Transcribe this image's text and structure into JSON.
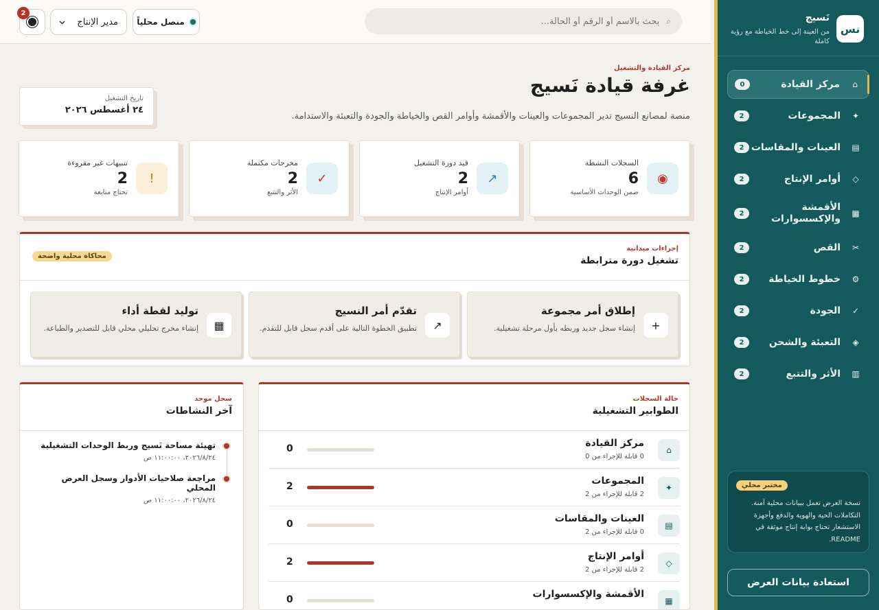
{
  "sidebar": {
    "brand_logo": "نس",
    "brand_name": "نَسيج",
    "brand_tagline": "من العينة إلى خط الخياطة مع رؤية كاملة",
    "items": [
      {
        "icon": "⌂",
        "label": "مركز القيادة",
        "count": "0",
        "active": true
      },
      {
        "icon": "✦",
        "label": "المجموعات",
        "count": "2"
      },
      {
        "icon": "▤",
        "label": "العينات والمقاسات",
        "count": "2"
      },
      {
        "icon": "◇",
        "label": "أوامر الإنتاج",
        "count": "2"
      },
      {
        "icon": "▦",
        "label": "الأقمشة والإكسسوارات",
        "count": "2"
      },
      {
        "icon": "✂",
        "label": "القص",
        "count": "2"
      },
      {
        "icon": "⚙",
        "label": "خطوط الخياطة",
        "count": "2"
      },
      {
        "icon": "✓",
        "label": "الجودة",
        "count": "2"
      },
      {
        "icon": "◈",
        "label": "التعبئة والشحن",
        "count": "2"
      },
      {
        "icon": "▥",
        "label": "الأثر والتتبع",
        "count": "2"
      }
    ],
    "note_pill": "مختبر محلي",
    "note_text": "نسخة العرض تعمل ببيانات محلية آمنة. التكاملات الحية والهوية والدفع وأجهزة الاستشعار تحتاج بوابة إنتاج موثقة في README.",
    "restore_label": "استعادة بيانات العرض"
  },
  "topbar": {
    "search_placeholder": "بحث بالاسم أو الرقم أو الحالة...",
    "status_label": "منصل محلياً",
    "role_value": "مدير الإنتاج",
    "notif_count": "2"
  },
  "header": {
    "eyebrow": "مركز القيادة والتشغيل",
    "title": "غرفة قيادة نَسيج",
    "lead": "منصة لمصانع النسيج تدير المجموعات والعينات والأقمشة وأوامر القص والخياطة والجودة والتعبئة والاستدامة.",
    "date_label": "تاريخ التشغيل",
    "date_value": "٢٤ أغسطس ٢٠٢٦"
  },
  "kpis": [
    {
      "label": "السجلات النشطة",
      "value": "6",
      "sub": "ضمن الوحدات الأساسية",
      "icon": "◉",
      "color": "#c0362c",
      "bg": "#e3f1f7"
    },
    {
      "label": "قيد دورة التشغيل",
      "value": "2",
      "sub": "أوامر الإنتاج",
      "icon": "↗",
      "color": "#3a7aa8",
      "bg": "#e3f1f7"
    },
    {
      "label": "مخرجات مكتملة",
      "value": "2",
      "sub": "الأثر والتتبع",
      "icon": "✓",
      "color": "#c0362c",
      "bg": "#e3f1f7"
    },
    {
      "label": "تنبيهات غير مقروءة",
      "value": "2",
      "sub": "تحتاج متابعة",
      "icon": "!",
      "color": "#c07a16",
      "bg": "#fcefd9"
    }
  ],
  "ops": {
    "eyebrow": "إجراءات ميدانية",
    "title": "تشغيل دورة مترابطة",
    "tag": "محاكاة محلية واضحة",
    "actions": [
      {
        "icon": "+",
        "title": "إطلاق أمر مجموعة",
        "desc": "إنشاء سجل جديد وربطه بأول مرحلة تشغيلية."
      },
      {
        "icon": "↗",
        "title": "تقدّم أمر النسيج",
        "desc": "تطبيق الخطوة التالية على أقدم سجل قابل للتقدم."
      },
      {
        "icon": "▦",
        "title": "توليد لقطة أداء",
        "desc": "إنشاء مخرج تحليلي محلي قابل للتصدير والطباعة."
      }
    ]
  },
  "queues": {
    "eyebrow": "حالة السجلات",
    "title": "الطوابير التشغيلية",
    "rows": [
      {
        "icon": "⌂",
        "title": "مركز القيادة",
        "sub": "0 قابلة للإجراء من 0",
        "value": "0",
        "progress": 0
      },
      {
        "icon": "✦",
        "title": "المجموعات",
        "sub": "2 قابلة للإجراء من 2",
        "value": "2",
        "progress": 1
      },
      {
        "icon": "▤",
        "title": "العينات والمقاسات",
        "sub": "0 قابلة للإجراء من 2",
        "value": "0",
        "progress": 0
      },
      {
        "icon": "◇",
        "title": "أوامر الإنتاج",
        "sub": "2 قابلة للإجراء من 2",
        "value": "2",
        "progress": 1
      },
      {
        "icon": "▦",
        "title": "الأقمشة والإكسسوارات",
        "sub": "",
        "value": "0",
        "progress": 0
      }
    ]
  },
  "activity": {
    "eyebrow": "سجل موحد",
    "title": "آخر النشاطات",
    "items": [
      {
        "title": "تهيئة مساحة نَسيج وربط الوحدات التشغيلية",
        "time": "٢٠٢٦/٨/٢٤، ١١:٠٠:٠٠ ص"
      },
      {
        "title": "مراجعة صلاحيات الأدوار وسجل العرض المحلي",
        "time": "٢٠٢٦/٨/٢٤، ١١:٠٠:٠٠ ص"
      }
    ]
  }
}
